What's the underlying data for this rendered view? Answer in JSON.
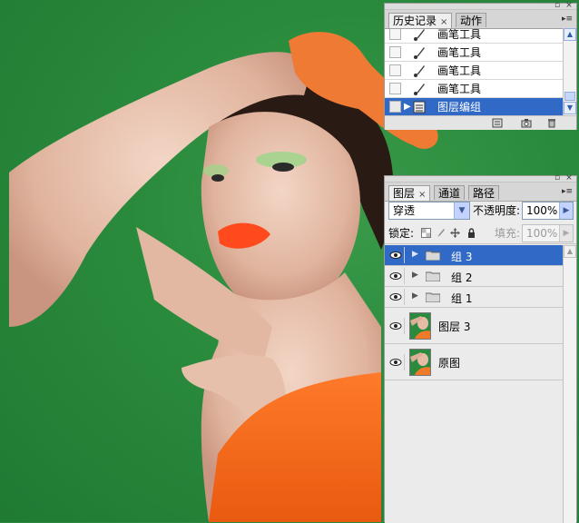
{
  "history_panel": {
    "tabs": [
      {
        "label": "历史记录",
        "active": true
      },
      {
        "label": "动作",
        "active": false
      }
    ],
    "items": [
      {
        "label": "画笔工具",
        "icon": "brush-icon",
        "selected": false
      },
      {
        "label": "画笔工具",
        "icon": "brush-icon",
        "selected": false
      },
      {
        "label": "画笔工具",
        "icon": "brush-icon",
        "selected": false
      },
      {
        "label": "画笔工具",
        "icon": "brush-icon",
        "selected": false
      },
      {
        "label": "图层编组",
        "icon": "layer-group-icon",
        "selected": true
      }
    ],
    "footer_icons": [
      "new-document-from-state-icon",
      "create-snapshot-icon",
      "trash-icon"
    ]
  },
  "layers_panel": {
    "tabs": [
      {
        "label": "图层",
        "active": true
      },
      {
        "label": "通道",
        "active": false
      },
      {
        "label": "路径",
        "active": false
      }
    ],
    "blend_mode": "穿透",
    "opacity_label": "不透明度:",
    "opacity_value": "100%",
    "lock_label": "锁定:",
    "fill_label": "填充:",
    "fill_value": "100%",
    "layers": [
      {
        "name": "组 3",
        "type": "group",
        "visible": true,
        "selected": true
      },
      {
        "name": "组 2",
        "type": "group",
        "visible": true,
        "selected": false
      },
      {
        "name": "组 1",
        "type": "group",
        "visible": true,
        "selected": false
      },
      {
        "name": "图层 3",
        "type": "layer",
        "visible": true,
        "selected": false
      },
      {
        "name": "原图",
        "type": "layer",
        "visible": true,
        "selected": false
      }
    ]
  },
  "colors": {
    "canvas_background": "#2c8a3e",
    "selection": "#3169c6",
    "panel_background": "#ececec"
  }
}
